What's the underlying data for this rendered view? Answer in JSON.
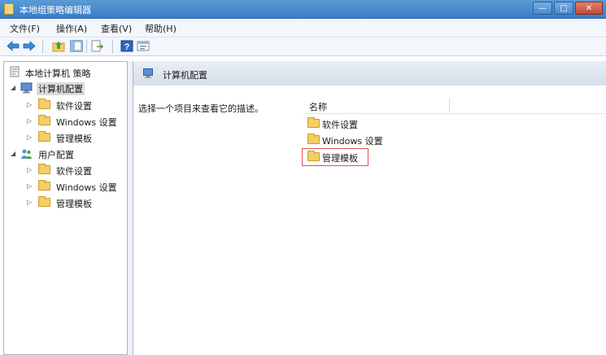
{
  "window": {
    "title": "本地组策略编辑器",
    "minimize": "—",
    "maximize": "□",
    "close": "✕"
  },
  "menu": [
    "文件(F)",
    "操作(A)",
    "查看(V)",
    "帮助(H)"
  ],
  "toolbar": {
    "icons": [
      "back-arrow-icon",
      "forward-arrow-icon",
      "up-folder-icon",
      "show-hide-tree-icon",
      "export-list-icon",
      "help-icon",
      "properties-icon"
    ]
  },
  "tree": {
    "root": "本地计算机 策略",
    "computer_config": "计算机配置",
    "user_config": "用户配置",
    "computer_children": [
      "软件设置",
      "Windows 设置",
      "管理模板"
    ],
    "user_children": [
      "软件设置",
      "Windows 设置",
      "管理模板"
    ],
    "selected": "计算机配置"
  },
  "content": {
    "header_title": "计算机配置",
    "description": "选择一个项目来查看它的描述。",
    "column_name": "名称",
    "items": [
      "软件设置",
      "Windows 设置",
      "管理模板"
    ],
    "highlighted_item": "管理模板"
  },
  "colors": {
    "titlebar": "#3a7cc6",
    "folder": "#f4cf67",
    "highlight": "#e05252",
    "selection": "#dcdcdc"
  }
}
